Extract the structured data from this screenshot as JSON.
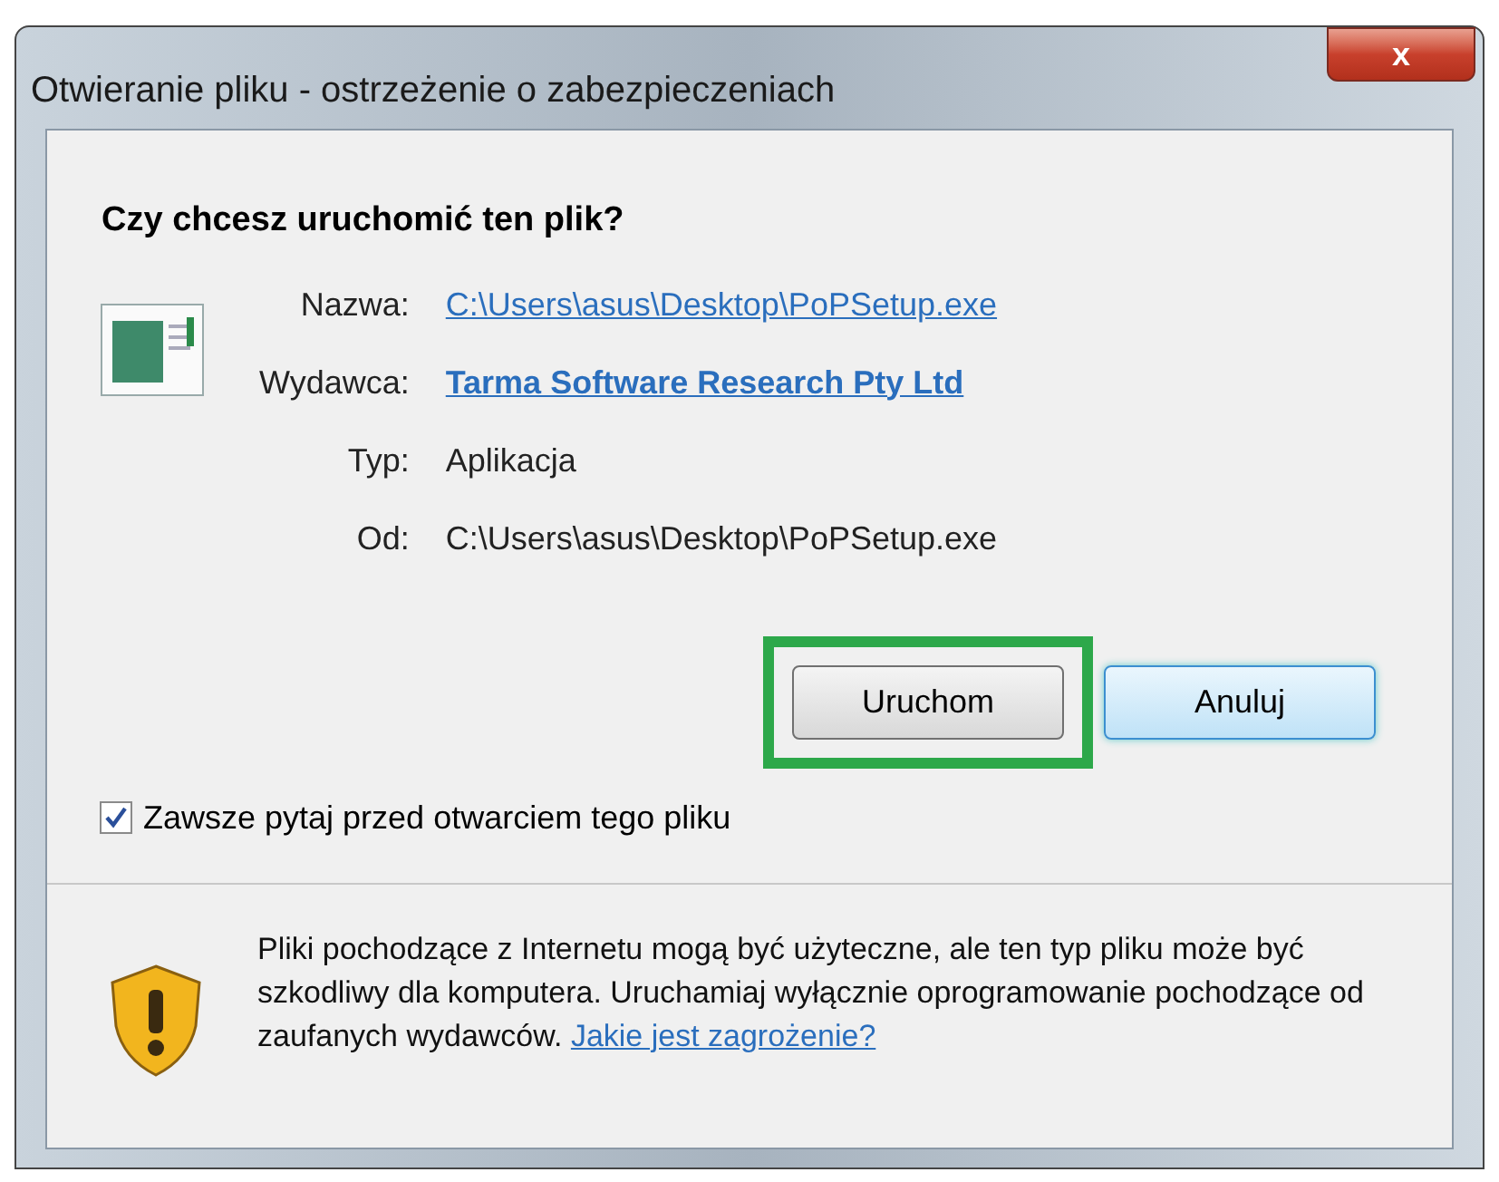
{
  "window": {
    "title": "Otwieranie pliku - ostrzeżenie o zabezpieczeniach",
    "close": "x"
  },
  "heading": "Czy chcesz uruchomić ten plik?",
  "details": [
    {
      "label": "Nazwa:",
      "value": "C:\\Users\\asus\\Desktop\\PoPSetup.exe",
      "kind": "link"
    },
    {
      "label": "Wydawca:",
      "value": "Tarma Software Research Pty Ltd",
      "kind": "bold-link"
    },
    {
      "label": "Typ:",
      "value": "Aplikacja",
      "kind": "text"
    },
    {
      "label": "Od:",
      "value": "C:\\Users\\asus\\Desktop\\PoPSetup.exe",
      "kind": "text"
    }
  ],
  "buttons": [
    {
      "label": "Uruchom",
      "highlighted": true,
      "focused": false
    },
    {
      "label": "Anuluj",
      "highlighted": false,
      "focused": true
    }
  ],
  "checkbox": {
    "label": "Zawsze pytaj przed otwarciem tego pliku",
    "checked": true
  },
  "warning": {
    "text": "Pliki pochodzące z Internetu mogą być użyteczne, ale ten typ pliku może być szkodliwy dla komputera. Uruchamiaj wyłącznie oprogramowanie pochodzące od zaufanych wydawców.",
    "link": "Jakie jest zagrożenie?"
  }
}
